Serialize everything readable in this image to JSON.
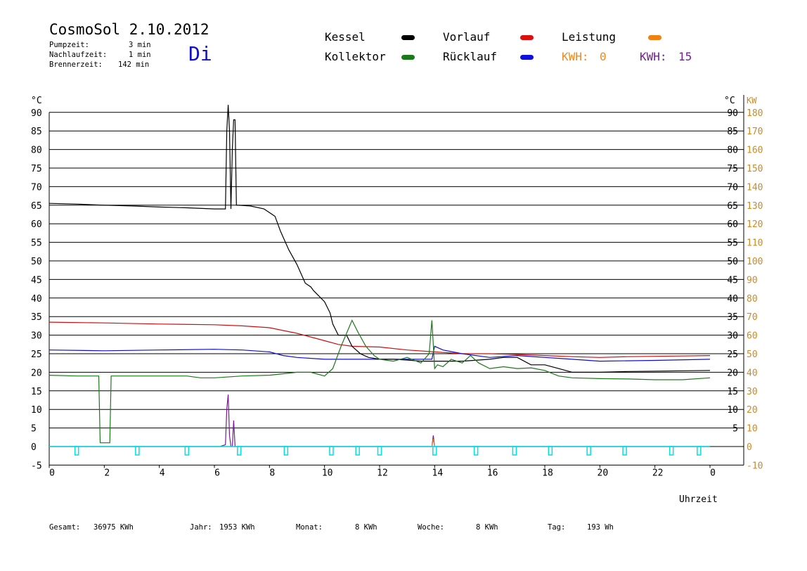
{
  "header": {
    "title": "CosmoSol 2.10.2012",
    "day": "Di",
    "pumpzeit_label": "Pumpzeit:",
    "pumpzeit_value": "3 min",
    "nachlauf_label": "Nachlaufzeit:",
    "nachlauf_value": "1 min",
    "brenner_label": "Brennerzeit:",
    "brenner_value": "142 min"
  },
  "legend": {
    "kessel": "Kessel",
    "kollektor": "Kollektor",
    "vorlauf": "Vorlauf",
    "ruecklauf": "Rücklauf",
    "leistung": "Leistung",
    "kwh_orange_label": "KWH:",
    "kwh_orange_value": "0",
    "kwh_purple_label": "KWH:",
    "kwh_purple_value": "15"
  },
  "colors": {
    "kessel": "#000000",
    "kollektor": "#1a7a1a",
    "vorlauf": "#cc1010",
    "ruecklauf": "#1010c8",
    "leistung": "#f07a10",
    "pump": "#7a1a9a",
    "pumpstate": "#00e0e8",
    "right_kw_axis": "#d08a20"
  },
  "footer": {
    "gesamt_label": "Gesamt:",
    "gesamt_value": "36975 KWh",
    "jahr_label": "Jahr:",
    "jahr_value": "1953 KWh",
    "monat_label": "Monat:",
    "monat_value": "8 KWh",
    "woche_label": "Woche:",
    "woche_value": "8 KWh",
    "tag_label": "Tag:",
    "tag_value": "193 Wh"
  },
  "chart_data": {
    "type": "line",
    "xlabel": "Uhrzeit",
    "ylabel_left": "°C",
    "ylabel_right_temp": "°C",
    "ylabel_right_power": "KW",
    "xlim": [
      0,
      24
    ],
    "ylim": [
      -5,
      92
    ],
    "x_ticks": [
      "0",
      "2",
      "4",
      "6",
      "8",
      "10",
      "12",
      "14",
      "16",
      "18",
      "20",
      "22",
      "0"
    ],
    "y_ticks_left": [
      "-5",
      "0",
      "5",
      "10",
      "15",
      "20",
      "25",
      "30",
      "35",
      "40",
      "45",
      "50",
      "55",
      "60",
      "65",
      "70",
      "75",
      "80",
      "85",
      "90"
    ],
    "y_ticks_right_temp": [
      "5",
      "10",
      "15",
      "20",
      "25",
      "30",
      "35",
      "40",
      "45",
      "50",
      "55",
      "60",
      "65",
      "70",
      "75",
      "80",
      "85",
      "90"
    ],
    "y_ticks_right_kw": [
      "-10",
      "0",
      "10",
      "20",
      "30",
      "40",
      "50",
      "60",
      "70",
      "80",
      "90",
      "100",
      "110",
      "120",
      "130",
      "140",
      "150",
      "160",
      "170",
      "180"
    ],
    "grid": true,
    "series": [
      {
        "name": "Kessel",
        "color": "#000000",
        "x": [
          0,
          1,
          2,
          3,
          4,
          5,
          6,
          6.4,
          6.45,
          6.5,
          6.55,
          6.6,
          6.65,
          6.7,
          6.75,
          6.8,
          6.85,
          7.3,
          7.8,
          8.2,
          8.4,
          8.7,
          9,
          9.3,
          9.5,
          9.6,
          10,
          10.2,
          10.3,
          10.5,
          10.8,
          11,
          11.3,
          11.6,
          12,
          12.5,
          13,
          13.5,
          14,
          14.5,
          15,
          16,
          16.5,
          17,
          17.5,
          18,
          18.5,
          19,
          19.5,
          20,
          21,
          22,
          23,
          24
        ],
        "y": [
          65.5,
          65.3,
          65,
          64.8,
          64.5,
          64.3,
          64,
          64,
          85,
          92,
          85,
          64,
          80,
          88,
          88,
          65,
          65,
          64.8,
          64,
          62,
          58,
          53,
          49,
          44,
          43,
          42,
          39,
          36,
          33,
          30,
          30,
          27,
          25,
          24,
          23.5,
          23.5,
          23.3,
          23,
          23,
          23,
          23,
          23.5,
          24,
          24,
          22,
          22,
          21,
          20,
          20,
          20,
          20.2,
          20.3,
          20.4,
          20.5
        ]
      },
      {
        "name": "Vorlauf",
        "color": "#cc1010",
        "x": [
          0,
          2,
          4,
          6,
          7,
          8,
          9,
          10,
          10.5,
          11,
          12,
          13,
          14,
          15,
          16,
          17,
          18,
          19,
          20,
          21,
          22,
          23,
          24
        ],
        "y": [
          33.5,
          33.3,
          33,
          32.8,
          32.5,
          32,
          30.5,
          28.5,
          27.5,
          27,
          26.8,
          26,
          25.5,
          25,
          25,
          24.8,
          24.5,
          24.2,
          24,
          24.2,
          24.3,
          24.4,
          24.5
        ]
      },
      {
        "name": "Rücklauf",
        "color": "#1010c8",
        "x": [
          0,
          2,
          4,
          6,
          7,
          8,
          8.5,
          9,
          10,
          11,
          12,
          13,
          13.9,
          14,
          14.3,
          15,
          16,
          17,
          18,
          19,
          20,
          22,
          24
        ],
        "y": [
          26,
          25.8,
          26,
          26.2,
          26,
          25.5,
          24.5,
          24,
          23.5,
          23.5,
          23.5,
          23.5,
          23.5,
          27,
          26,
          25,
          24,
          24.5,
          24,
          23.5,
          23,
          23.2,
          23.5
        ]
      },
      {
        "name": "Kollektor",
        "color": "#1a7a1a",
        "x": [
          0,
          1,
          1.8,
          1.85,
          2.2,
          2.25,
          3,
          4,
          5,
          5.5,
          6,
          7,
          8,
          9,
          9.5,
          10,
          10.3,
          10.6,
          11,
          11.2,
          11.5,
          11.8,
          12,
          12.5,
          13,
          13.5,
          13.8,
          13.9,
          14,
          14.1,
          14.3,
          14.6,
          15,
          15.3,
          15.6,
          16,
          16.5,
          17,
          17.5,
          18,
          18.5,
          19,
          20,
          21,
          22,
          23,
          24
        ],
        "y": [
          19.2,
          19,
          19,
          1,
          1,
          19,
          19,
          19,
          19,
          18.5,
          18.5,
          19,
          19.2,
          20,
          20,
          19,
          21,
          27,
          34,
          31,
          27,
          24.5,
          23.5,
          23,
          24,
          22.5,
          25,
          34,
          21,
          22,
          21.5,
          23.5,
          22.5,
          24.5,
          22.5,
          21,
          21.5,
          21,
          21.2,
          20.5,
          19,
          18.5,
          18.3,
          18.2,
          18,
          18,
          18.5
        ]
      },
      {
        "name": "Pumpe",
        "color": "#7a1a9a",
        "x": [
          0,
          6.2,
          6.4,
          6.45,
          6.5,
          6.55,
          6.6,
          6.65,
          6.7,
          6.75,
          6.8,
          6.85,
          13.9,
          13.95,
          14,
          14.05,
          24
        ],
        "y": [
          0,
          0,
          0.5,
          10,
          14,
          3,
          0,
          0,
          7,
          0,
          0,
          0,
          0,
          3,
          0,
          0,
          0
        ]
      },
      {
        "name": "Leistung",
        "color": "#f07a10",
        "x": [
          0,
          13.9,
          13.95,
          14,
          14.05,
          24
        ],
        "y": [
          0,
          0,
          2,
          0,
          0,
          0
        ]
      }
    ],
    "pump_pulses_x": [
      1.0,
      3.2,
      5.0,
      6.9,
      8.6,
      10.25,
      11.2,
      12.0,
      14.0,
      15.5,
      16.9,
      18.2,
      19.6,
      20.9,
      22.6,
      23.6
    ],
    "pump_pulse_color": "#00e0e8"
  }
}
